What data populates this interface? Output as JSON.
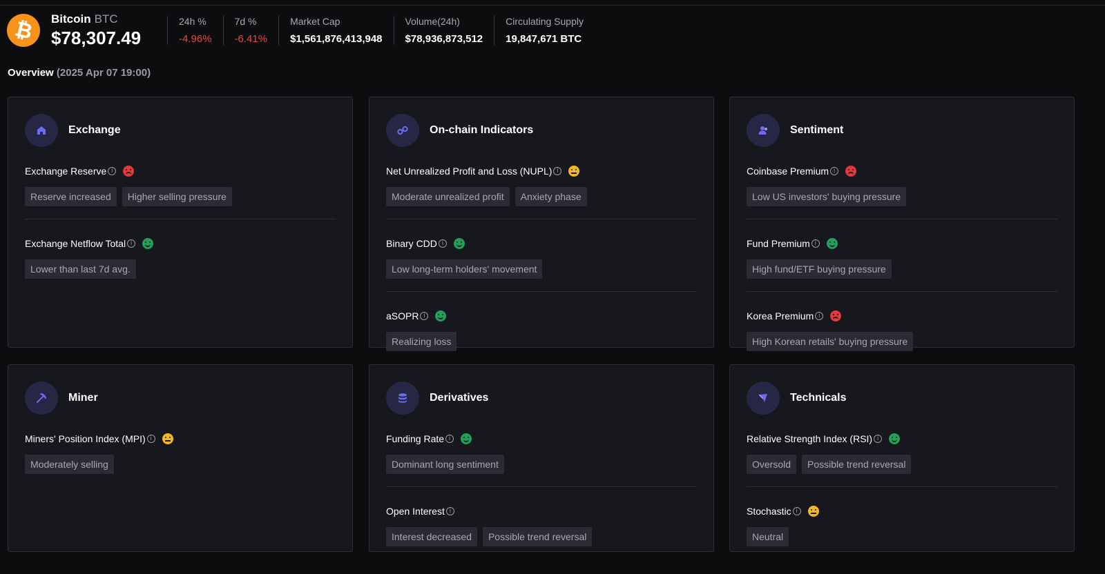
{
  "coin": {
    "name": "Bitcoin",
    "symbol": "BTC",
    "price": "$78,307.49",
    "logo_glyph": "₿",
    "logo_color": "#f7931a"
  },
  "stats": [
    {
      "label": "24h %",
      "value": "-4.96%",
      "negative": true
    },
    {
      "label": "7d %",
      "value": "-6.41%",
      "negative": true
    },
    {
      "label": "Market Cap",
      "value": "$1,561,876,413,948"
    },
    {
      "label": "Volume(24h)",
      "value": "$78,936,873,512"
    },
    {
      "label": "Circulating Supply",
      "value": "19,847,671 BTC"
    }
  ],
  "overview": {
    "label": "Overview",
    "timestamp": "(2025 Apr 07 19:00)"
  },
  "info_glyph": "i",
  "colors": {
    "bad": "#e03a3a",
    "good": "#22a05a",
    "neutral": "#f2b824",
    "negative_change": "#e24a4a",
    "accent": "#6c6cf0"
  },
  "cards": [
    {
      "title": "Exchange",
      "icon": "building-icon",
      "metrics": [
        {
          "name": "Exchange Reserve",
          "status": "bad",
          "tags": [
            "Reserve increased",
            "Higher selling pressure"
          ]
        },
        {
          "name": "Exchange Netflow Total",
          "status": "good",
          "tags": [
            "Lower than last 7d avg."
          ]
        }
      ]
    },
    {
      "title": "On-chain Indicators",
      "icon": "chain-link-icon",
      "metrics": [
        {
          "name": "Net Unrealized Profit and Loss (NUPL)",
          "status": "neutral",
          "tags": [
            "Moderate unrealized profit",
            "Anxiety phase"
          ]
        },
        {
          "name": "Binary CDD",
          "status": "good",
          "tags": [
            "Low long-term holders' movement"
          ]
        },
        {
          "name": "aSOPR",
          "status": "good",
          "tags": [
            "Realizing loss"
          ]
        }
      ]
    },
    {
      "title": "Sentiment",
      "icon": "users-icon",
      "metrics": [
        {
          "name": "Coinbase Premium",
          "status": "bad",
          "tags": [
            "Low US investors' buying pressure"
          ]
        },
        {
          "name": "Fund Premium",
          "status": "good",
          "tags": [
            "High fund/ETF buying pressure"
          ]
        },
        {
          "name": "Korea Premium",
          "status": "bad",
          "tags": [
            "High Korean retails' buying pressure"
          ]
        }
      ]
    },
    {
      "title": "Miner",
      "icon": "pickaxe-icon",
      "metrics": [
        {
          "name": "Miners' Position Index (MPI)",
          "status": "neutral",
          "tags": [
            "Moderately selling"
          ]
        }
      ]
    },
    {
      "title": "Derivatives",
      "icon": "database-icon",
      "metrics": [
        {
          "name": "Funding Rate",
          "status": "good",
          "tags": [
            "Dominant long sentiment"
          ]
        },
        {
          "name": "Open Interest",
          "status": "none",
          "tags": [
            "Interest decreased",
            "Possible trend reversal"
          ]
        }
      ]
    },
    {
      "title": "Technicals",
      "icon": "pointer-icon",
      "metrics": [
        {
          "name": "Relative Strength Index (RSI)",
          "status": "good",
          "tags": [
            "Oversold",
            "Possible trend reversal"
          ]
        },
        {
          "name": "Stochastic",
          "status": "neutral",
          "tags": [
            "Neutral"
          ]
        }
      ]
    }
  ]
}
